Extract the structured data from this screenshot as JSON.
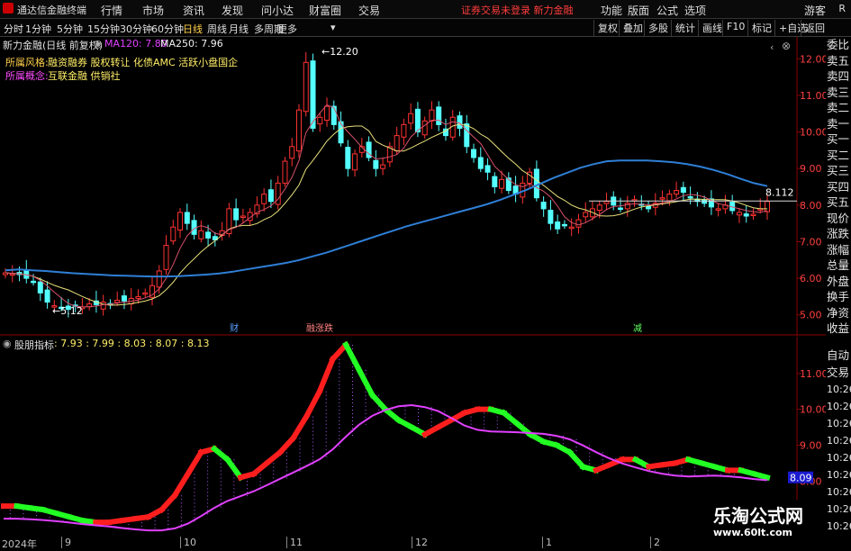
{
  "app": {
    "title": "通达信金融终端",
    "close": "R"
  },
  "menu": [
    "行情",
    "市场",
    "资讯",
    "发现",
    "问小达",
    "财富圈",
    "交易"
  ],
  "trade_status": "证券交易未登录  新力金融",
  "menu_right": [
    "功能",
    "版面",
    "公式",
    "选项",
    "游客"
  ],
  "periods": [
    "分时",
    "1分钟",
    "5分钟",
    "15分钟",
    "30分钟",
    "60分钟",
    "日线",
    "周线",
    "月线",
    "多周期",
    "更多"
  ],
  "active_period": "日线",
  "toolbar_right": [
    "复权",
    "叠加",
    "多股",
    "统计",
    "画线",
    "F10",
    "标记",
    "+自选",
    "返回"
  ],
  "main_info": {
    "stock_title": "新力金融(日线 前复权)",
    "ma120": "MA120: 7.80",
    "ma250": "MA250: 7.96",
    "style_label": "所属风格:",
    "style_value": "融资融券 股权转让 化债AMC 活跃小盘国企",
    "concept_label": "所属概念:",
    "concept_value": "互联金融 供销社",
    "high_label": "12.20",
    "low_label": "5.12",
    "last_label": "8.112",
    "events": [
      "财",
      "融涨跌",
      "减"
    ]
  },
  "sub_info": {
    "indicator_name": "股朋指标",
    "values": ": 7.93 : 7.99 : 8.03 : 8.07 : 8.13",
    "current_tag": "8.09"
  },
  "sidebar_top": [
    "委比",
    "卖五",
    "卖四",
    "卖三",
    "卖二",
    "卖一",
    "买一",
    "买二",
    "买三",
    "买四",
    "买五",
    "现价",
    "涨跌",
    "涨幅",
    "总量",
    "外盘",
    "换手",
    "净资",
    "收益"
  ],
  "sidebar_bottom": [
    "自动",
    "交易",
    "10:26",
    "10:26",
    "10:26",
    "10:26",
    "10:26",
    "10:26",
    "10:26",
    "10:26",
    "10:26"
  ],
  "xaxis": [
    "2024年",
    "9",
    "10",
    "11",
    "12",
    "1",
    "2"
  ],
  "watermark": {
    "line1": "乐淘公式网",
    "line2": "www.60lt.com"
  },
  "colors": {
    "up": "#ff3232",
    "down": "#54ffff",
    "ma_blue": "#2f7fd6",
    "ma_yellow": "#e8e07a",
    "ma_red": "#d8506b",
    "sub_green": "#22ff22",
    "sub_red": "#ff1e1e",
    "sub_magenta": "#e040ff"
  },
  "chart_data": [
    {
      "type": "line",
      "title": "新力金融(日线 前复权)",
      "ylim": [
        4.6,
        12.4
      ],
      "yticks": [
        5.0,
        6.0,
        7.0,
        8.0,
        9.0,
        10.0,
        11.0,
        12.0
      ],
      "series": [
        {
          "name": "MA120",
          "values": [
            6.22,
            6.24,
            6.22,
            6.2,
            6.17,
            6.14,
            6.12,
            6.1,
            6.08,
            6.07,
            6.06,
            6.05,
            6.05,
            6.06,
            6.08,
            6.1,
            6.13,
            6.18,
            6.24,
            6.3,
            6.36,
            6.42,
            6.5,
            6.6,
            6.7,
            6.82,
            6.94,
            7.06,
            7.18,
            7.3,
            7.42,
            7.52,
            7.62,
            7.72,
            7.82,
            7.92,
            8.02,
            8.14,
            8.28,
            8.42,
            8.58,
            8.74,
            8.88,
            9.02,
            9.12,
            9.2,
            9.22,
            9.22,
            9.22,
            9.2,
            9.17,
            9.12,
            9.05,
            8.96,
            8.85,
            8.72,
            8.6,
            8.52
          ]
        },
        {
          "name": "MA250",
          "values": [
            8.1,
            8.1,
            8.09,
            8.09,
            8.08,
            8.08,
            8.08,
            8.07,
            8.07,
            8.06,
            8.06,
            8.06,
            8.06,
            8.05
          ]
        }
      ]
    },
    {
      "type": "line",
      "title": "股朋指标",
      "ylim": [
        6.5,
        11.9
      ],
      "yticks": [
        7.0,
        8.0,
        9.0,
        10.0,
        11.0
      ],
      "series": [
        {
          "name": "股朋指标",
          "values": [
            7.93,
            7.99,
            8.03,
            8.07,
            8.13
          ]
        }
      ]
    }
  ]
}
